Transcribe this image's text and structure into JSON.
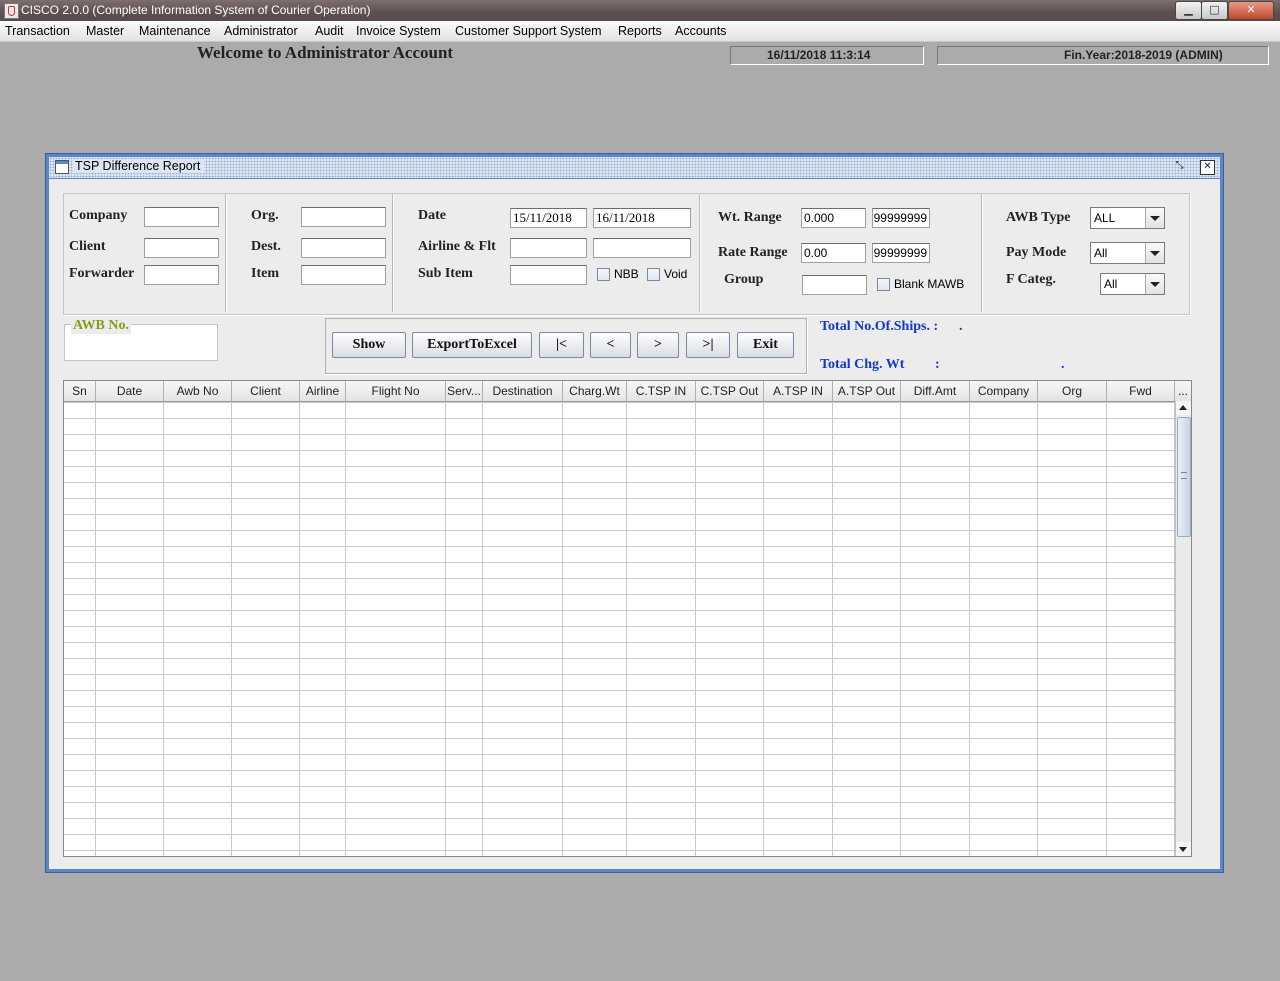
{
  "window": {
    "title": "CISCO 2.0.0 (Complete Information System of Courier Operation)",
    "min_glyph": "▁",
    "max_glyph": "□",
    "close_glyph": "✕"
  },
  "menu": [
    "Transaction",
    "Master",
    "Maintenance",
    "Administrator",
    "Audit",
    "Invoice System",
    "Customer Support System",
    "Reports",
    "Accounts"
  ],
  "header": {
    "welcome": "Welcome to Administrator Account",
    "datetime": "16/11/2018     11:3:14",
    "fin_year": "Fin.Year:2018-2019  (ADMIN)"
  },
  "frame": {
    "title": "TSP Difference Report",
    "restore_glyph": "⤡",
    "close_glyph": "✕"
  },
  "filters": {
    "company_label": "Company",
    "client_label": "Client",
    "forwarder_label": "Forwarder",
    "org_label": "Org.",
    "dest_label": "Dest.",
    "item_label": "Item",
    "date_label": "Date",
    "date_from": "15/11/2018",
    "date_to": "16/11/2018",
    "airline_label": "Airline & Flt",
    "subitem_label": "Sub Item",
    "nbb_label": "NBB",
    "void_label": "Void",
    "wt_range_label": "Wt. Range",
    "wt_from": "0.000",
    "wt_to": "99999999",
    "rate_range_label": "Rate Range",
    "rate_from": "0.00",
    "rate_to": "99999999",
    "group_label": "Group",
    "blank_mawb_label": "Blank MAWB",
    "awb_type_label": "AWB Type",
    "awb_type_value": "ALL",
    "pay_mode_label": "Pay Mode",
    "pay_mode_value": "All",
    "f_categ_label": "F Categ.",
    "f_categ_value": "All"
  },
  "awb_group": {
    "label": "AWB No."
  },
  "buttons": {
    "show": "Show",
    "export": "ExportToExcel",
    "first": "|<",
    "prev": "<",
    "next": ">",
    "last": ">|",
    "exit": "Exit"
  },
  "totals": {
    "ships_label": "Total No.Of.Ships. :",
    "ships_value": ".",
    "chg_wt_label": "Total Chg. Wt",
    "chg_wt_colon": ":",
    "chg_wt_value": "."
  },
  "table": {
    "columns": [
      "Sn",
      "Date",
      "Awb No",
      "Client",
      "Airline",
      "Flight No",
      "Serv...",
      "Destination",
      "Charg.Wt",
      "C.TSP IN",
      "C.TSP Out",
      "A.TSP IN",
      "A.TSP Out",
      "Diff.Amt",
      "Company",
      "Org",
      "Fwd",
      "..."
    ]
  }
}
